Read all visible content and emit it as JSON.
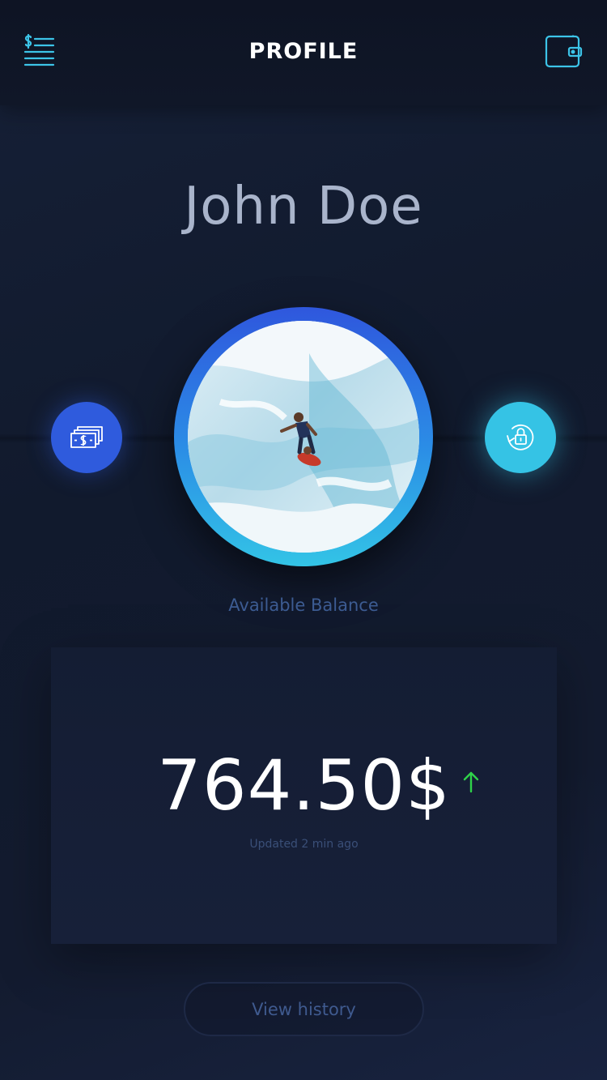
{
  "header": {
    "title": "PROFILE",
    "menu_icon": "dollar-list-icon",
    "wallet_icon": "wallet-icon"
  },
  "profile": {
    "name": "John Doe",
    "avatar_alt": "surfer-photo"
  },
  "actions": {
    "left_icon": "money-stack-icon",
    "right_icon": "lock-refresh-icon"
  },
  "balance": {
    "label": "Available Balance",
    "amount": "764.50$",
    "trend_icon": "arrow-up-icon",
    "updated": "Updated 2 min ago"
  },
  "footer": {
    "history_label": "View history"
  },
  "colors": {
    "accent_blue": "#2f5bdd",
    "accent_cyan": "#35c3e5",
    "trend_up": "#2fd34a",
    "background": "#141b2e"
  }
}
